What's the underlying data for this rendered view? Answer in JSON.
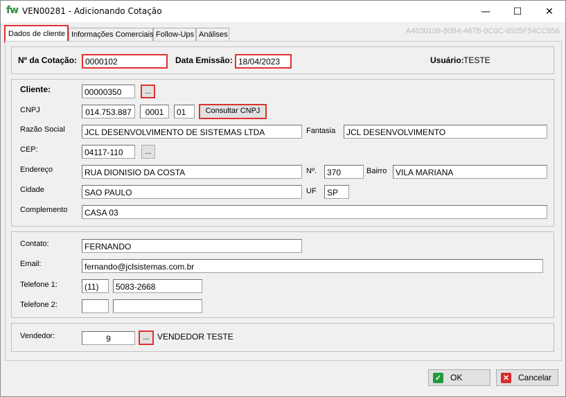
{
  "window": {
    "logo": "fw",
    "title": "VEN00281 -  Adicionando Cotação",
    "minimize": "—",
    "maximize": "☐",
    "close": "✕"
  },
  "tabs": [
    {
      "label": "Dados de cliente",
      "active": true
    },
    {
      "label": "Informações Comerciais",
      "active": false
    },
    {
      "label": "Follow-Ups",
      "active": false
    },
    {
      "label": "Análises",
      "active": false
    }
  ],
  "guid": "A4030109-80B4-467B-9C0C-8525F54CC956",
  "header": {
    "cotacao_label": "Nº da Cotação:",
    "cotacao_value": "0000102",
    "emissao_label": "Data Emissão:",
    "emissao_value": "18/04/2023",
    "usuario_label": "Usuário:",
    "usuario_value": "TESTE"
  },
  "cliente": {
    "cliente_label": "Cliente:",
    "cliente_value": "00000350",
    "lookup_label": "...",
    "cnpj_label": "CNPJ",
    "cnpj_part1": "014.753.887",
    "cnpj_part2": "0001",
    "cnpj_part3": "01",
    "consultar_label": "Consultar CNPJ",
    "razao_label": "Razão Social",
    "razao_value": "JCL DESENVOLVIMENTO DE SISTEMAS LTDA",
    "fantasia_label": "Fantasia",
    "fantasia_value": "JCL DESENVOLVIMENTO",
    "cep_label": "CEP:",
    "cep_value": "04117-110",
    "cep_lookup_label": "...",
    "endereco_label": "Endereço",
    "endereco_value": "RUA DIONISIO DA COSTA",
    "numero_label": "Nº.",
    "numero_value": "370",
    "bairro_label": "Bairro",
    "bairro_value": "VILA MARIANA",
    "cidade_label": "Cidade",
    "cidade_value": "SAO PAULO",
    "uf_label": "UF",
    "uf_value": "SP",
    "complemento_label": "Complemento",
    "complemento_value": "CASA 03"
  },
  "contato": {
    "contato_label": "Contato:",
    "contato_value": "FERNANDO",
    "email_label": "Email:",
    "email_value": "fernando@jclsistemas.com.br",
    "tel1_label": "Telefone 1:",
    "tel1_ddd": "(11)",
    "tel1_number": "5083-2668",
    "tel2_label": "Telefone 2:",
    "tel2_ddd": "",
    "tel2_number": ""
  },
  "vendedor": {
    "label": "Vendedor:",
    "code": "9",
    "lookup_label": "...",
    "name": "VENDEDOR TESTE"
  },
  "footer": {
    "ok_label": "OK",
    "cancel_label": "Cancelar"
  },
  "colors": {
    "highlight": "#e03030",
    "logo_green": "#2e8b3a",
    "ok_icon": "#1f9b3a",
    "cancel_icon": "#d32b2b"
  }
}
